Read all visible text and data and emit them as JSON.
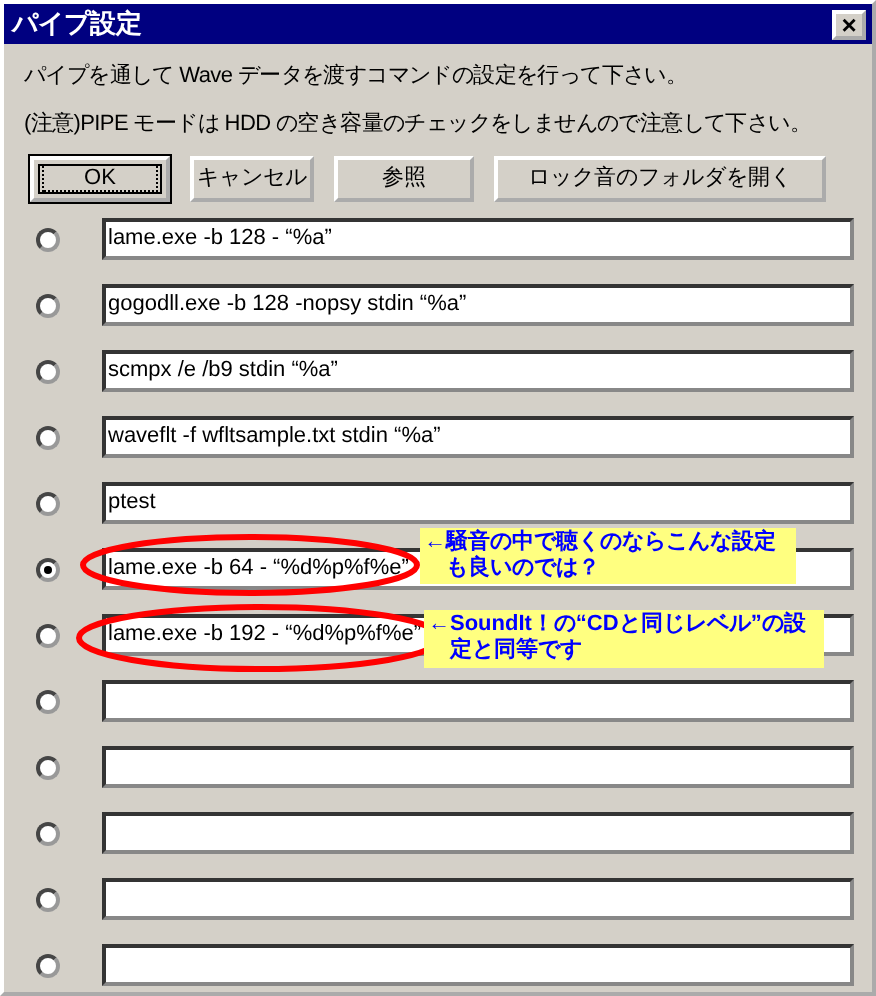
{
  "window": {
    "title": "パイプ設定",
    "close": "×"
  },
  "messages": [
    "パイプを通して Wave データを渡すコマンドの設定を行って下さい。",
    "(注意)PIPE モードは HDD の空き容量のチェックをしませんので注意して下さい。"
  ],
  "buttons": [
    {
      "label": "OK",
      "default": true
    },
    {
      "label": "キャンセル",
      "default": false
    },
    {
      "label": "参照",
      "default": false
    },
    {
      "label": "ロック音のフォルダを開く",
      "default": false
    }
  ],
  "commands": [
    {
      "value": "lame.exe -b 128 - “%a”",
      "selected": false
    },
    {
      "value": "gogodll.exe -b 128 -nopsy stdin “%a”",
      "selected": false
    },
    {
      "value": "scmpx /e /b9 stdin “%a”",
      "selected": false
    },
    {
      "value": "waveflt -f wfltsample.txt stdin “%a”",
      "selected": false
    },
    {
      "value": "ptest",
      "selected": false
    },
    {
      "value": "lame.exe -b 64 - “%d%p%f%e”",
      "selected": true,
      "note": "←騒音の中で聴くのならこんな設定も良いのでは？"
    },
    {
      "value": "lame.exe -b 192 - “%d%p%f%e”",
      "selected": false,
      "note": "←SoundIt！の“CDと同じレベル”の設定と同等です"
    },
    {
      "selected": false
    },
    {
      "selected": false
    },
    {
      "selected": false
    },
    {
      "selected": false
    },
    {
      "selected": false
    }
  ]
}
